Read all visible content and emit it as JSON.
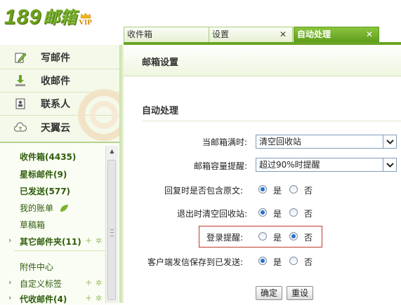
{
  "logo": {
    "number": "189",
    "name": "邮箱",
    "vip": "VIP"
  },
  "tabs": [
    {
      "label": "收件箱",
      "closable": false,
      "active": false
    },
    {
      "label": "设置",
      "closable": true,
      "active": false,
      "close": "✕"
    },
    {
      "label": "自动处理",
      "closable": true,
      "active": true,
      "close": "✕"
    }
  ],
  "sidebar": {
    "quick": [
      {
        "label": "写邮件",
        "icon": "compose-icon"
      },
      {
        "label": "收邮件",
        "icon": "receive-icon"
      },
      {
        "label": "联系人",
        "icon": "contacts-icon"
      },
      {
        "label": "天翼云",
        "icon": "cloud-icon"
      }
    ],
    "folders": {
      "inbox": {
        "label": "收件箱",
        "count": "(4435)"
      },
      "starred": {
        "label": "星标邮件",
        "count": "(9)"
      },
      "sent": {
        "label": "已发送",
        "count": "(577)"
      },
      "account": {
        "label": "我的账单"
      },
      "drafts": {
        "label": "草稿箱"
      },
      "other": {
        "label": "其它邮件夹",
        "count": "(11)"
      },
      "attachments": {
        "label": "附件中心"
      },
      "tags": {
        "label": "自定义标签"
      },
      "proxy": {
        "label": "代收邮件",
        "count": "(4)"
      }
    }
  },
  "main": {
    "header": "邮箱设置",
    "section_title": "自动处理",
    "rows": {
      "full": {
        "label": "当邮箱满时:",
        "value": "清空回收站"
      },
      "capacity": {
        "label": "邮箱容量提醒:",
        "value": "超过90%时提醒"
      },
      "reply": {
        "label": "回复时是否包含原文:",
        "yes": "是",
        "no": "否",
        "selected": "yes"
      },
      "logout": {
        "label": "退出时清空回收站:",
        "yes": "是",
        "no": "否",
        "selected": "yes"
      },
      "login": {
        "label": "登录提醒:",
        "yes": "是",
        "no": "否",
        "selected": "no"
      },
      "client": {
        "label": "客户端发信保存到已发送:",
        "yes": "是",
        "no": "否",
        "selected": "yes"
      }
    },
    "buttons": {
      "confirm": "确定",
      "reset": "重设"
    }
  },
  "colors": {
    "brand_green": "#6aa522",
    "highlight": "#c0392b",
    "radio_dot": "#2a6fd1"
  }
}
